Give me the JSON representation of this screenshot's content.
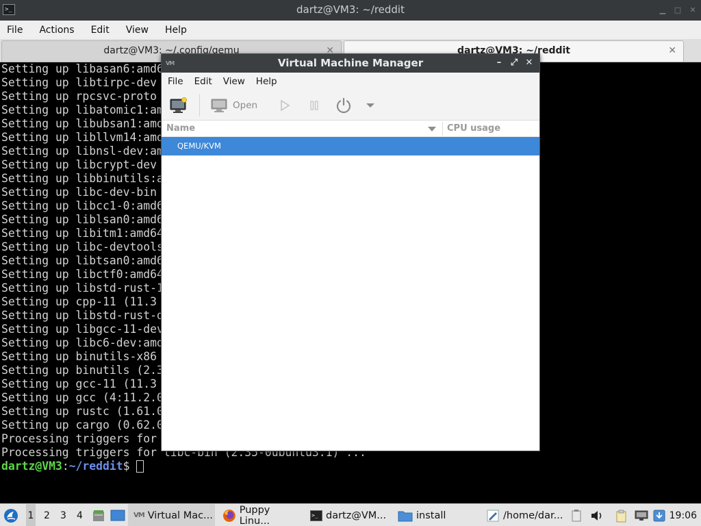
{
  "terminal": {
    "title": "dartz@VM3: ~/reddit",
    "menu": [
      "File",
      "Actions",
      "Edit",
      "View",
      "Help"
    ],
    "tabs": [
      {
        "label": "dartz@VM3: ~/.config/qemu",
        "active": false
      },
      {
        "label": "dartz@VM3: ~/reddit",
        "active": true
      }
    ],
    "lines": [
      "Setting up libasan6:amd6",
      "Setting up libtirpc-dev",
      "Setting up rpcsvc-proto",
      "Setting up libatomic1:am",
      "Setting up libubsan1:amd",
      "Setting up libllvm14:amd",
      "Setting up libnsl-dev:am",
      "Setting up libcrypt-dev",
      "Setting up libbinutils:a",
      "Setting up libc-dev-bin",
      "Setting up libcc1-0:amd6",
      "Setting up liblsan0:amd6",
      "Setting up libitm1:amd64",
      "Setting up libc-devtools",
      "Setting up libtsan0:amd6",
      "Setting up libctf0:amd64",
      "Setting up libstd-rust-1",
      "Setting up cpp-11 (11.3",
      "Setting up libstd-rust-d",
      "Setting up libgcc-11-dev",
      "Setting up libc6-dev:amd",
      "Setting up binutils-x86",
      "Setting up binutils (2.3",
      "Setting up gcc-11 (11.3",
      "Setting up gcc (4:11.2.0",
      "Setting up rustc (1.61.0",
      "Setting up cargo (0.62.0",
      "Processing triggers for",
      "Processing triggers for libc-bin (2.35-0ubuntu3.1) ..."
    ],
    "prompt_user": "dartz@VM3",
    "prompt_sep": ":",
    "prompt_path": "~/reddit",
    "prompt_symbol": "$ "
  },
  "vmm": {
    "title": "Virtual Machine Manager",
    "menu": [
      "File",
      "Edit",
      "View",
      "Help"
    ],
    "toolbar": {
      "open_label": "Open"
    },
    "columns": {
      "name": "Name",
      "cpu": "CPU usage"
    },
    "rows": [
      {
        "label": "QEMU/KVM",
        "selected": true
      }
    ]
  },
  "taskbar": {
    "workspaces": [
      "1",
      "2",
      "3",
      "4"
    ],
    "tasks": [
      {
        "label": "Virtual Mac...",
        "icon": "vmm-icon"
      },
      {
        "label": "Puppy Linu...",
        "icon": "firefox-icon"
      },
      {
        "label": "dartz@VM...",
        "icon": "terminal-icon"
      },
      {
        "label": "install",
        "icon": "folder-icon"
      },
      {
        "label": "/home/dar...",
        "icon": "text-editor-icon"
      }
    ],
    "clock": "19:06"
  }
}
